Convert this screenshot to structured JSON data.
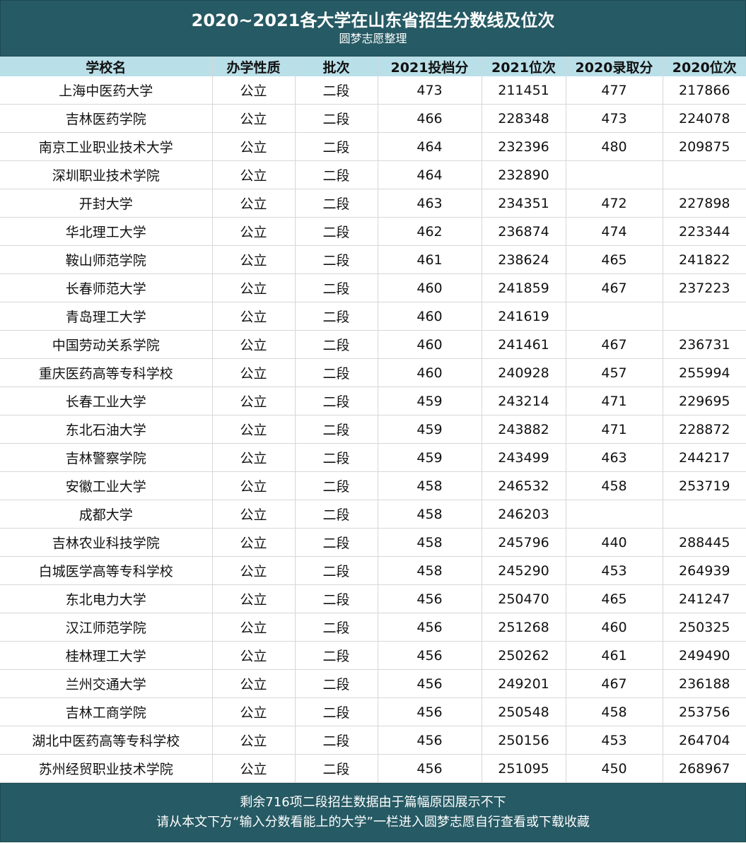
{
  "header": {
    "title": "2020~2021各大学在山东省招生分数线及位次",
    "subtitle": "圆梦志愿整理"
  },
  "columns": [
    "学校名",
    "办学性质",
    "批次",
    "2021投档分",
    "2021位次",
    "2020录取分",
    "2020位次"
  ],
  "rows": [
    [
      "上海中医药大学",
      "公立",
      "二段",
      "473",
      "211451",
      "477",
      "217866"
    ],
    [
      "吉林医药学院",
      "公立",
      "二段",
      "466",
      "228348",
      "473",
      "224078"
    ],
    [
      "南京工业职业技术大学",
      "公立",
      "二段",
      "464",
      "232396",
      "480",
      "209875"
    ],
    [
      "深圳职业技术学院",
      "公立",
      "二段",
      "464",
      "232890",
      "",
      ""
    ],
    [
      "开封大学",
      "公立",
      "二段",
      "463",
      "234351",
      "472",
      "227898"
    ],
    [
      "华北理工大学",
      "公立",
      "二段",
      "462",
      "236874",
      "474",
      "223344"
    ],
    [
      "鞍山师范学院",
      "公立",
      "二段",
      "461",
      "238624",
      "465",
      "241822"
    ],
    [
      "长春师范大学",
      "公立",
      "二段",
      "460",
      "241859",
      "467",
      "237223"
    ],
    [
      "青岛理工大学",
      "公立",
      "二段",
      "460",
      "241619",
      "",
      ""
    ],
    [
      "中国劳动关系学院",
      "公立",
      "二段",
      "460",
      "241461",
      "467",
      "236731"
    ],
    [
      "重庆医药高等专科学校",
      "公立",
      "二段",
      "460",
      "240928",
      "457",
      "255994"
    ],
    [
      "长春工业大学",
      "公立",
      "二段",
      "459",
      "243214",
      "471",
      "229695"
    ],
    [
      "东北石油大学",
      "公立",
      "二段",
      "459",
      "243882",
      "471",
      "228872"
    ],
    [
      "吉林警察学院",
      "公立",
      "二段",
      "459",
      "243499",
      "463",
      "244217"
    ],
    [
      "安徽工业大学",
      "公立",
      "二段",
      "458",
      "246532",
      "458",
      "253719"
    ],
    [
      "成都大学",
      "公立",
      "二段",
      "458",
      "246203",
      "",
      ""
    ],
    [
      "吉林农业科技学院",
      "公立",
      "二段",
      "458",
      "245796",
      "440",
      "288445"
    ],
    [
      "白城医学高等专科学校",
      "公立",
      "二段",
      "458",
      "245290",
      "453",
      "264939"
    ],
    [
      "东北电力大学",
      "公立",
      "二段",
      "456",
      "250470",
      "465",
      "241247"
    ],
    [
      "汉江师范学院",
      "公立",
      "二段",
      "456",
      "251268",
      "460",
      "250325"
    ],
    [
      "桂林理工大学",
      "公立",
      "二段",
      "456",
      "250262",
      "461",
      "249490"
    ],
    [
      "兰州交通大学",
      "公立",
      "二段",
      "456",
      "249201",
      "467",
      "236188"
    ],
    [
      "吉林工商学院",
      "公立",
      "二段",
      "456",
      "250548",
      "458",
      "253756"
    ],
    [
      "湖北中医药高等专科学校",
      "公立",
      "二段",
      "456",
      "250156",
      "453",
      "264704"
    ],
    [
      "苏州经贸职业技术学院",
      "公立",
      "二段",
      "456",
      "251095",
      "450",
      "268967"
    ]
  ],
  "footer": {
    "line1": "剩余716项二段招生数据由于篇幅原因展示不下",
    "line2": "请从本文下方“输入分数看能上的大学”一栏进入圆梦志愿自行查看或下载收藏"
  },
  "colors": {
    "banner": "#265a64",
    "header_row": "#b9dfe8",
    "grid": "#d7d7d7"
  }
}
